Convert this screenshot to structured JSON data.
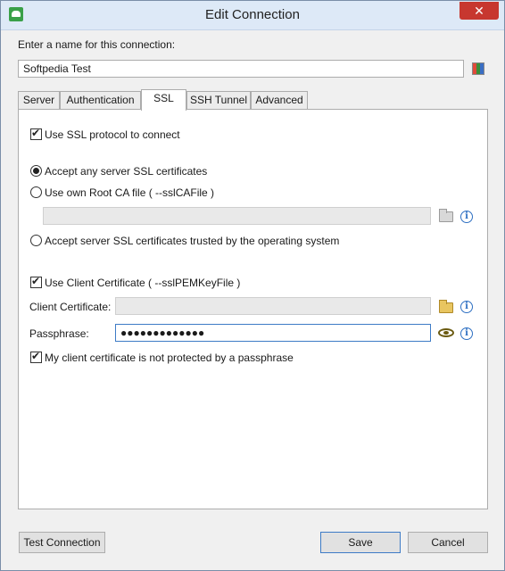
{
  "window": {
    "title": "Edit Connection",
    "close": "✕"
  },
  "name_prompt": "Enter a name for this connection:",
  "connection_name": "Softpedia Test",
  "tabs": [
    {
      "label": "Server"
    },
    {
      "label": "Authentication"
    },
    {
      "label": "SSL"
    },
    {
      "label": "SSH Tunnel"
    },
    {
      "label": "Advanced"
    }
  ],
  "ssl": {
    "use_ssl_label": "Use SSL protocol to connect",
    "accept_any_label": "Accept any server SSL certificates",
    "own_ca_label": "Use own Root CA file ( --sslCAFile )",
    "own_ca_value": "",
    "trusted_os_label": "Accept server SSL certificates trusted by the operating system",
    "use_client_cert_label": "Use Client Certificate ( --sslPEMKeyFile )",
    "client_cert_label": "Client Certificate:",
    "client_cert_value": "",
    "passphrase_label": "Passphrase:",
    "passphrase_value": "●●●●●●●●●●●●●",
    "not_protected_label": "My client certificate is not protected by a passphrase",
    "info_glyph": "i"
  },
  "buttons": {
    "test": "Test Connection",
    "save": "Save",
    "cancel": "Cancel"
  },
  "colors": {
    "accent": "#3d7bc6",
    "close": "#c7372f",
    "info": "#2d6fc2"
  }
}
